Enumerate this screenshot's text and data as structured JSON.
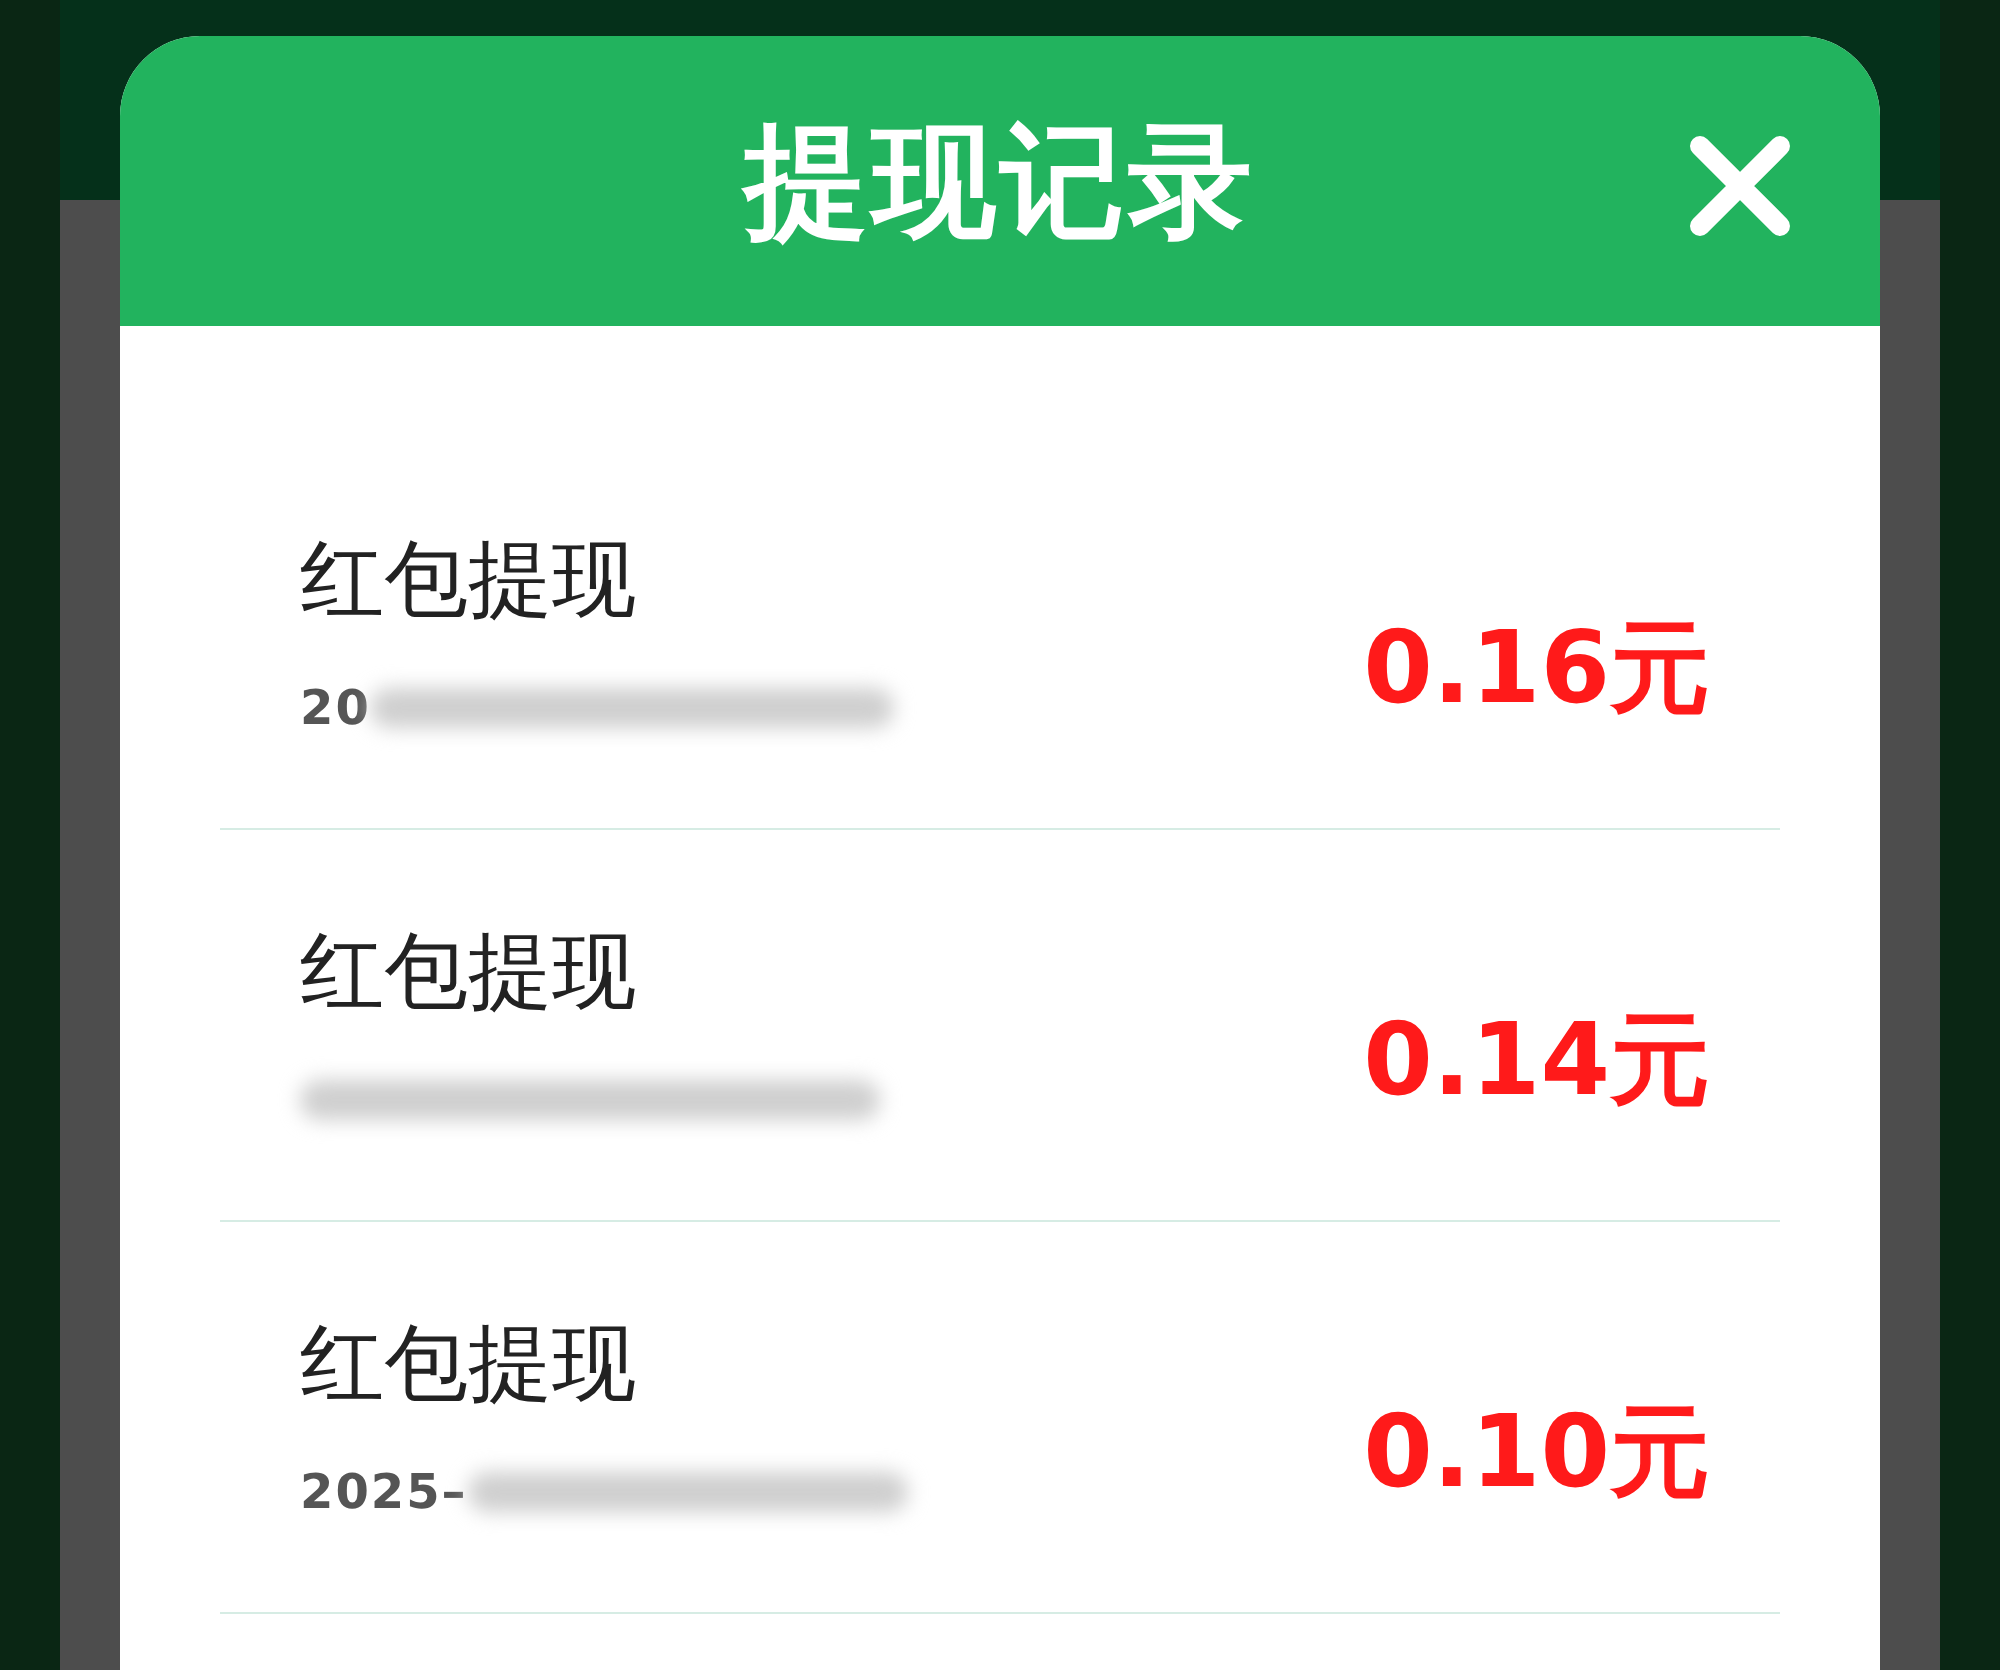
{
  "dialog": {
    "title": "提现记录",
    "records": [
      {
        "title": "红包提现",
        "date": "20",
        "amount": "0.16元"
      },
      {
        "title": "红包提现",
        "amount": "0.14元"
      },
      {
        "title": "红包提现",
        "date": "2025–",
        "amount": "0.10元"
      }
    ]
  }
}
